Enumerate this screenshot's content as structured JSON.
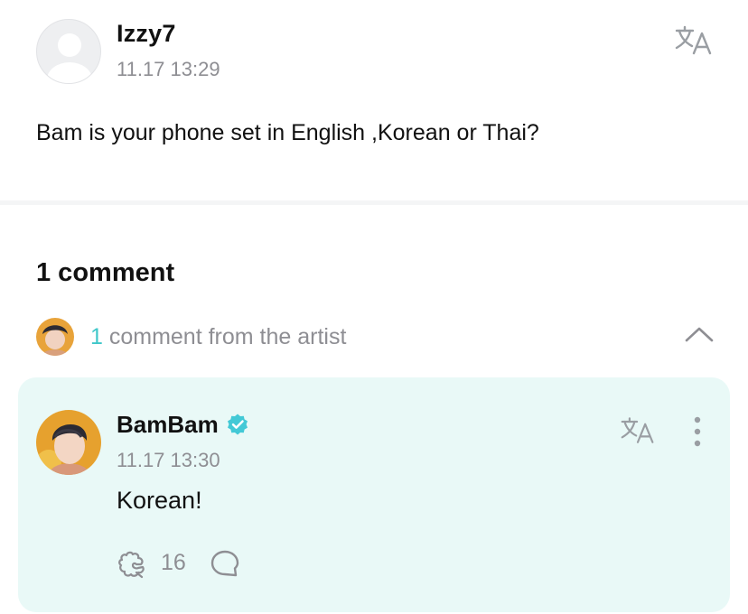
{
  "post": {
    "author": "Izzy7",
    "timestamp": "11.17 13:29",
    "text": "Bam is your phone set in English ,Korean or Thai?",
    "translate_icon": "translate-icon"
  },
  "comments": {
    "count_label": "1 comment",
    "artist_count": "1",
    "artist_label": " comment from the artist",
    "collapse_icon": "chevron-up-icon"
  },
  "artist_comment": {
    "author": "BamBam",
    "verified_icon": "verified-badge-icon",
    "timestamp": "11.17 13:30",
    "text": "Korean!",
    "like_count": "16",
    "colors": {
      "card_bg": "#e9f9f7",
      "accent": "#3fc7c9"
    }
  }
}
